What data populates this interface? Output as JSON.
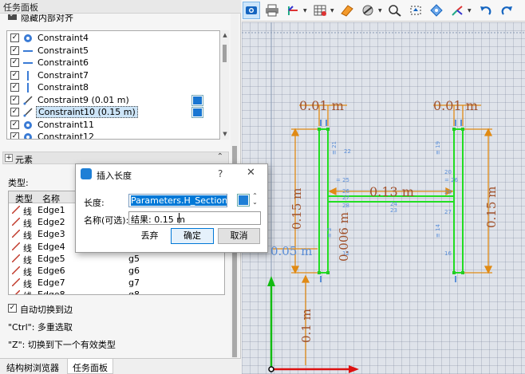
{
  "panel": {
    "title": "任务面板",
    "cut_row_label": "隐藏内部对齐",
    "constraints": [
      {
        "label": "Constraint4",
        "checked": true,
        "icon": "circle-dot-icon",
        "selected": false,
        "expr_button": false
      },
      {
        "label": "Constraint5",
        "checked": true,
        "icon": "horizontal-line-icon",
        "selected": false,
        "expr_button": false
      },
      {
        "label": "Constraint6",
        "checked": true,
        "icon": "horizontal-line-icon",
        "selected": false,
        "expr_button": false
      },
      {
        "label": "Constraint7",
        "checked": true,
        "icon": "vertical-line-icon",
        "selected": false,
        "expr_button": false
      },
      {
        "label": "Constraint8",
        "checked": true,
        "icon": "vertical-line-icon",
        "selected": false,
        "expr_button": false
      },
      {
        "label": "Constraint9 (0.01 m)",
        "checked": true,
        "icon": "dimension-icon",
        "selected": false,
        "expr_button": true
      },
      {
        "label": "Constraint10 (0.15 m)",
        "checked": true,
        "icon": "dimension-icon",
        "selected": true,
        "expr_button": true
      },
      {
        "label": "Constraint11",
        "checked": true,
        "icon": "circle-dot-icon",
        "selected": false,
        "expr_button": false
      },
      {
        "label": "Constraint12",
        "checked": true,
        "icon": "circle-dot-icon",
        "selected": false,
        "expr_button": false
      }
    ],
    "elements_title": "元素",
    "elements_toggle": "+",
    "type_label": "类型:",
    "table_headers": {
      "type": "类型",
      "name": "名称"
    },
    "edges": [
      {
        "type": "线",
        "name": "Edge1",
        "group": ""
      },
      {
        "type": "线",
        "name": "Edge2",
        "group": ""
      },
      {
        "type": "线",
        "name": "Edge3",
        "group": ""
      },
      {
        "type": "线",
        "name": "Edge4",
        "group": "g4"
      },
      {
        "type": "线",
        "name": "Edge5",
        "group": "g5"
      },
      {
        "type": "线",
        "name": "Edge6",
        "group": "g6"
      },
      {
        "type": "线",
        "name": "Edge7",
        "group": "g7"
      },
      {
        "type": "线",
        "name": "Edge8",
        "group": "g8"
      }
    ],
    "auto_switch": {
      "label": "自动切换到边",
      "checked": true
    },
    "hint_ctrl": "\"Ctrl\": 多重选取",
    "hint_z": "\"Z\": 切换到下一个有效类型",
    "tabs": {
      "structure": "结构树浏览器",
      "task": "任务面板"
    }
  },
  "toolbar": {
    "buttons": [
      "view-camera-icon",
      "print-icon",
      "axis-icon",
      "grid-icon",
      "snap-icon",
      "section-icon",
      "fit-selection-icon",
      "fit-all-icon",
      "rotate-icon",
      "undo-icon",
      "redo-icon"
    ]
  },
  "sketch": {
    "dim_labels": {
      "top_left": "0.01 m",
      "top_right": "0.01 m",
      "height_left": "0.15 m",
      "height_right": "0.15 m",
      "web_width": "0.13 m",
      "web_thickness": "0.006 m",
      "left_offset": "0.05 m",
      "bottom_offset": "0.1 m"
    },
    "colors": {
      "geometry": "#22dd22",
      "dimension": "#e08a14",
      "constraint": "#5b8fd9",
      "dim_label": "#a0522d",
      "axis_x": "#dd1111",
      "axis_y": "#11bb11"
    }
  },
  "dialog": {
    "title": "插入长度",
    "help": "?",
    "close": "✕",
    "length_label": "长度:",
    "length_value": "Parameters.H_Section_L",
    "name_label": "名称(可选):",
    "name_value": "结果: 0.15 m",
    "discard_label": "丢弃",
    "ok_label": "确定",
    "cancel_label": "取消"
  }
}
